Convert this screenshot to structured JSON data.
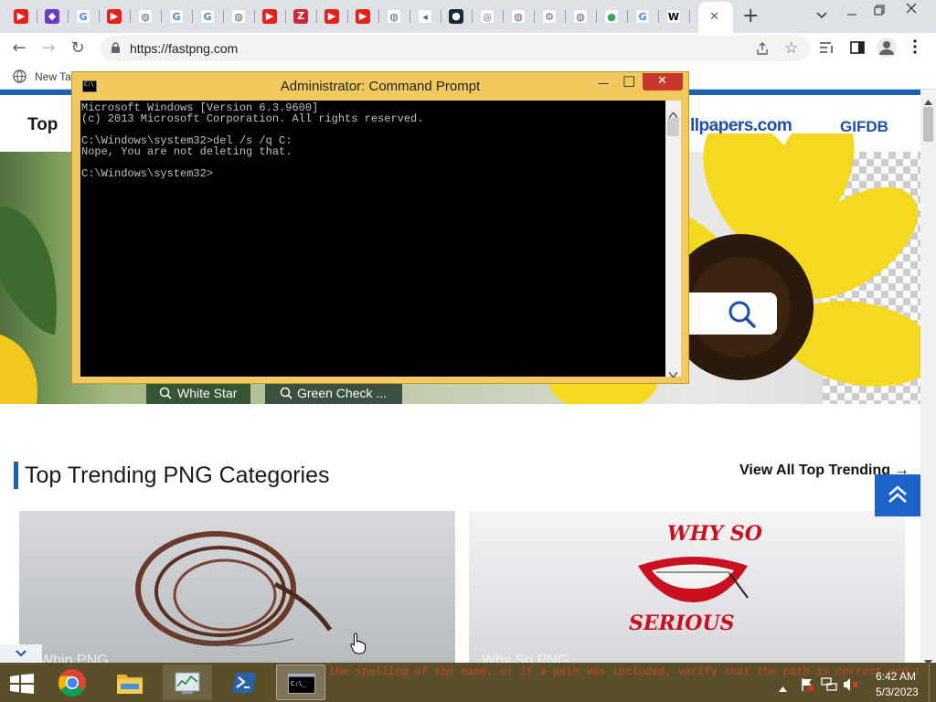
{
  "browser": {
    "tabs": [
      {
        "icon": "youtube-icon",
        "color": "#e62117"
      },
      {
        "icon": "purple-app-icon",
        "color": "#6a3bc9"
      },
      {
        "icon": "google-icon",
        "color": "#4285f4"
      },
      {
        "icon": "youtube-icon",
        "color": "#e62117"
      },
      {
        "icon": "globe-icon",
        "color": "#5f6368"
      },
      {
        "icon": "google-icon",
        "color": "#4285f4"
      },
      {
        "icon": "google-icon",
        "color": "#4285f4"
      },
      {
        "icon": "globe-icon",
        "color": "#5f6368"
      },
      {
        "icon": "youtube-icon",
        "color": "#e62117"
      },
      {
        "icon": "zotero-icon",
        "color": "#cc2936"
      },
      {
        "icon": "youtube-icon",
        "color": "#e62117"
      },
      {
        "icon": "youtube-icon",
        "color": "#e62117"
      },
      {
        "icon": "globe-icon",
        "color": "#5f6368"
      },
      {
        "icon": "speaker-icon",
        "color": "#5f6368"
      },
      {
        "icon": "steam-icon",
        "color": "#1b2838"
      },
      {
        "icon": "chromium-icon",
        "color": "#5f6368"
      },
      {
        "icon": "globe-icon",
        "color": "#5f6368"
      },
      {
        "icon": "settings-icon",
        "color": "#5f6368"
      },
      {
        "icon": "globe-icon",
        "color": "#5f6368"
      },
      {
        "icon": "maps-icon",
        "color": "#34a853"
      },
      {
        "icon": "google-icon",
        "color": "#4285f4"
      },
      {
        "icon": "wikipedia-icon",
        "color": "#000000"
      },
      {
        "icon": "globe-icon",
        "color": "#5f6368"
      }
    ],
    "active_tab_close": "✕",
    "new_tab": "+",
    "url": "https://fastpng.com",
    "bookmark_new_tab": "New Ta"
  },
  "site": {
    "logo_text": "Top",
    "partner1": "llpapers.com",
    "partner2": "GIFDB",
    "chips": [
      "White Star",
      "Green Check ..."
    ],
    "section_title": "Top Trending PNG Categories",
    "view_all": "View All Top Trending →",
    "card1_label": "Whip PNG",
    "card2_label": "Why So PNG",
    "card2_art_top": "WHY SO",
    "card2_art_bottom": "SERIOUS"
  },
  "cmd": {
    "title": "Administrator:  Command Prompt",
    "lines": [
      "Microsoft Windows [Version 6.3.9600]",
      "(c) 2013 Microsoft Corporation. All rights reserved.",
      "",
      "C:\\Windows\\system32>del /s /q C:",
      "Nope, You are not deleting that.",
      "",
      "C:\\Windows\\system32>"
    ],
    "icon_text": "C:\\",
    "minimize": "—",
    "maximize": "□",
    "close": "✕"
  },
  "taskbar": {
    "ghost_text": " the spelling of the name, or if a path was included, verify that the path is correct and try again.",
    "time": "6:42 AM",
    "date": "5/3/2023",
    "pinned": [
      "windows-start-icon",
      "chrome-icon",
      "file-explorer-icon",
      "task-manager-icon",
      "powershell-icon",
      "command-prompt-icon"
    ]
  }
}
